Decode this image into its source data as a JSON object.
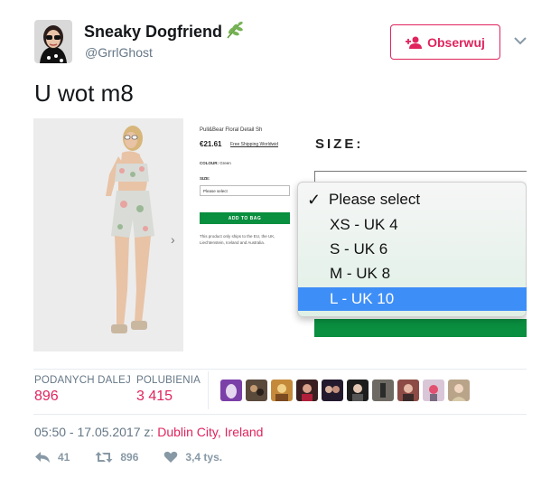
{
  "user": {
    "name": "Sneaky Dogfriend",
    "handle": "@GrrlGhost",
    "emoji": "herb-icon"
  },
  "follow": {
    "label": "Obserwuj",
    "icon": "add-person-icon"
  },
  "more_icon": "chevron-down-icon",
  "tweet": {
    "text": "U wot m8"
  },
  "media": {
    "product_title": "Pull&Bear Floral Detail Sh",
    "price": "€21.61",
    "shipping": "Free Shipping Worldwid",
    "colour_label": "COLOUR:",
    "colour_value": "Green",
    "size_label_small": "SIZE:",
    "select_placeholder": "Please select",
    "add_to_bag": "ADD TO BAG",
    "ships_note": "This product only ships to the EU, the UK, Liechtenstein, Iceland and Australia.",
    "next_arrow": "›",
    "zoom_size_label": "SIZE:",
    "dropdown": {
      "check": "✓",
      "options": [
        "Please select",
        "XS - UK 4",
        "S - UK 6",
        "M - UK 8",
        "L - UK 10"
      ],
      "selected": "L - UK 10"
    }
  },
  "stats": {
    "retweets_label": "PODANYCH DALEJ",
    "retweets_value": "896",
    "likes_label": "POLUBIENIA",
    "likes_value": "3 415"
  },
  "likers_avatars": [
    "avatar-1",
    "avatar-2",
    "avatar-3",
    "avatar-4",
    "avatar-5",
    "avatar-6",
    "avatar-7",
    "avatar-8",
    "avatar-9",
    "avatar-10"
  ],
  "meta": {
    "time": "05:50 - 17.05.2017 z:",
    "location": "Dublin City, Ireland"
  },
  "actions": {
    "replies": "41",
    "retweets": "896",
    "likes": "3,4 tys."
  },
  "colors": {
    "accent": "#e0245e",
    "secondary_text": "#657786",
    "select_highlight": "#3e8ef7",
    "add_button": "#0a8e3f"
  }
}
